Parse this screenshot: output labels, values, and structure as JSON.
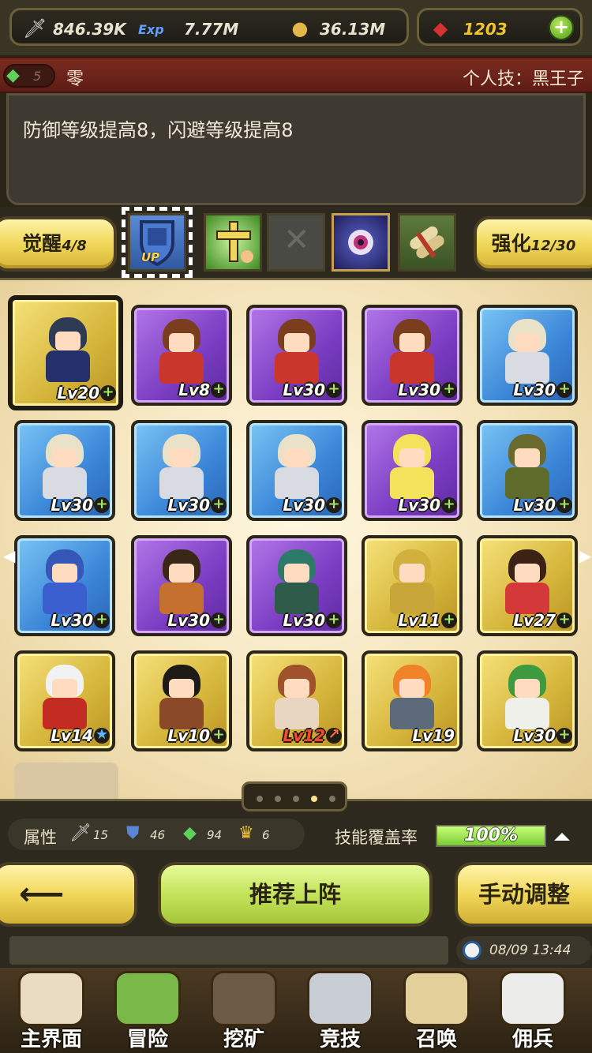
{
  "resources": {
    "attack": {
      "icon": "sword-icon",
      "value": "846.39K"
    },
    "exp": {
      "icon": "exp-icon",
      "value": "7.77M"
    },
    "gold": {
      "icon": "gold-coins-icon",
      "value": "36.13M"
    },
    "gems": {
      "icon": "ruby-icon",
      "value": "1203",
      "color": "#f0c431"
    },
    "add_button": "+"
  },
  "skill": {
    "gem_count": "5",
    "name": "零",
    "personal_label": "个人技：黑王子"
  },
  "description": "防御等级提高8，闪避等级提高8",
  "tabs": {
    "awaken": {
      "label": "觉醒",
      "progress": "4/8"
    },
    "enhance": {
      "label": "强化",
      "progress": "12/30"
    },
    "icons": [
      "shield-up-icon",
      "holy-cross-icon",
      "locked-slot-icon",
      "evil-eye-icon",
      "scroll-bundle-icon"
    ],
    "up_badge": "UP",
    "locked_mark": "✕"
  },
  "heroes": [
    {
      "level": "Lv20",
      "tier": "gold",
      "hair": "#2f3a55",
      "body": "#24306a",
      "badge": "plus",
      "selected": true
    },
    {
      "level": "Lv8",
      "tier": "purple",
      "hair": "#7a3e1e",
      "body": "#c9362b",
      "badge": "plus"
    },
    {
      "level": "Lv30",
      "tier": "purple",
      "hair": "#7a3e1e",
      "body": "#c9362b",
      "badge": "plus"
    },
    {
      "level": "Lv30",
      "tier": "purple",
      "hair": "#7a3e1e",
      "body": "#c9362b",
      "badge": "plus"
    },
    {
      "level": "Lv30",
      "tier": "blue",
      "hair": "#e9e2c9",
      "body": "#d8dbe2",
      "badge": "plus"
    },
    {
      "level": "Lv30",
      "tier": "blue",
      "hair": "#e9e2c9",
      "body": "#d8dbe2",
      "badge": "plus"
    },
    {
      "level": "Lv30",
      "tier": "blue",
      "hair": "#e9e2c9",
      "body": "#d8dbe2",
      "badge": "plus"
    },
    {
      "level": "Lv30",
      "tier": "blue",
      "hair": "#e9e2c9",
      "body": "#d8dbe2",
      "badge": "plus"
    },
    {
      "level": "Lv30",
      "tier": "purple",
      "hair": "#f4e35a",
      "body": "#f4e35a",
      "badge": "plus"
    },
    {
      "level": "Lv30",
      "tier": "blue",
      "hair": "#6b6a2e",
      "body": "#5f6b2a",
      "badge": "plus"
    },
    {
      "level": "Lv30",
      "tier": "blue",
      "hair": "#3656b8",
      "body": "#3c5fd0",
      "badge": "plus"
    },
    {
      "level": "Lv30",
      "tier": "purple",
      "hair": "#3a2718",
      "body": "#c5702e",
      "badge": "plus"
    },
    {
      "level": "Lv30",
      "tier": "purple",
      "hair": "#2e7a6a",
      "body": "#2f5c4a",
      "badge": "plus"
    },
    {
      "level": "Lv11",
      "tier": "gold",
      "hair": "#d2b03e",
      "body": "#c9a63a",
      "badge": "plus"
    },
    {
      "level": "Lv27",
      "tier": "gold",
      "hair": "#3b2214",
      "body": "#d43838",
      "badge": "plus"
    },
    {
      "level": "Lv14",
      "tier": "gold",
      "hair": "#f2f2f2",
      "body": "#c22c22",
      "badge": "star"
    },
    {
      "level": "Lv10",
      "tier": "gold",
      "hair": "#1e1a16",
      "body": "#8a4a2a",
      "badge": "plus"
    },
    {
      "level": "Lv12",
      "tier": "gold",
      "hair": "#a0522d",
      "body": "#e8d6c0",
      "badge": "arrow",
      "level_color": "#ff4a2a"
    },
    {
      "level": "Lv19",
      "tier": "gold",
      "hair": "#f0822a",
      "body": "#5c6a7a",
      "badge": "none"
    },
    {
      "level": "Lv30",
      "tier": "gold",
      "hair": "#3e9a3e",
      "body": "#f0f0ea",
      "badge": "plus"
    }
  ],
  "pager": {
    "pages": 5,
    "active": 3
  },
  "stats": {
    "label": "属性",
    "items": [
      {
        "icon": "sword-icon",
        "value": "15"
      },
      {
        "icon": "shield-icon",
        "value": "46"
      },
      {
        "icon": "gem-icon",
        "value": "94"
      },
      {
        "icon": "crown-icon",
        "value": "6"
      }
    ],
    "coverage_label": "技能覆盖率",
    "coverage_value": "100%",
    "coverage_fraction": 1.0
  },
  "actions": {
    "back_icon": "arrow-left-icon",
    "recommend_label": "推荐上阵",
    "manual_label": "手动调整"
  },
  "status": {
    "time": "08/09 13:44"
  },
  "nav": [
    {
      "label": "主界面",
      "icon": "map-scroll-icon",
      "color": "#e9dcc2"
    },
    {
      "label": "冒险",
      "icon": "island-icon",
      "color": "#7bb84a"
    },
    {
      "label": "挖矿",
      "icon": "pickaxe-icon",
      "color": "#6a5a46"
    },
    {
      "label": "竞技",
      "icon": "crossed-swords-icon",
      "color": "#c9cdd4"
    },
    {
      "label": "召唤",
      "icon": "summon-scroll-icon",
      "color": "#e3cf9a"
    },
    {
      "label": "佣兵",
      "icon": "tent-icon",
      "color": "#ececea"
    }
  ]
}
